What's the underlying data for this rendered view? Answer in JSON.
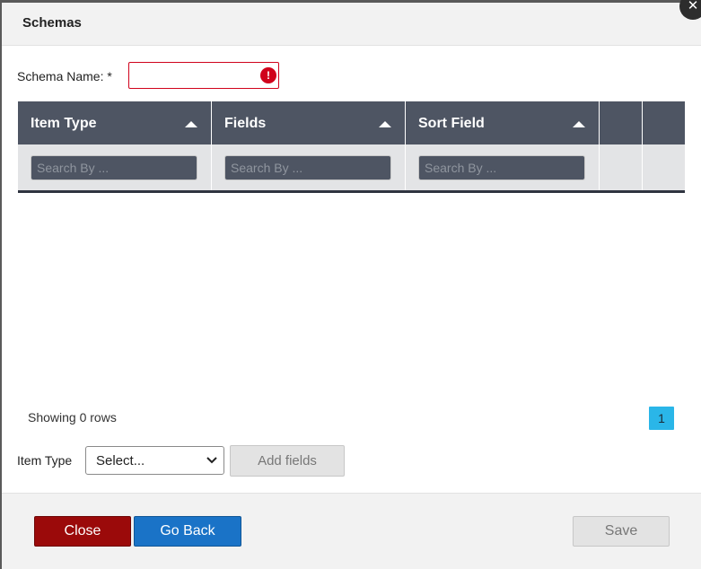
{
  "dialog": {
    "title": "Schemas",
    "close_glyph": "✕"
  },
  "form": {
    "schema_name_label": "Schema Name: *",
    "schema_name_value": "",
    "error_icon": "!"
  },
  "grid": {
    "columns": [
      {
        "label": "Item Type",
        "sort_icon": "sort-asc-icon"
      },
      {
        "label": "Fields",
        "sort_icon": "sort-asc-icon"
      },
      {
        "label": "Sort Field",
        "sort_icon": "sort-asc-icon"
      }
    ],
    "filter_placeholder": "Search By ...",
    "rows": []
  },
  "pagination": {
    "status": "Showing 0 rows",
    "current_page": "1"
  },
  "item_type": {
    "label": "Item Type",
    "selected": "Select...",
    "add_button": "Add fields"
  },
  "footer": {
    "close": "Close",
    "go_back": "Go Back",
    "save": "Save"
  },
  "colors": {
    "header_bg": "#4e5563",
    "error": "#d0021b",
    "close_button": "#9b0a0a",
    "go_back_button": "#1a73c7",
    "page_active": "#2ab6e8"
  }
}
